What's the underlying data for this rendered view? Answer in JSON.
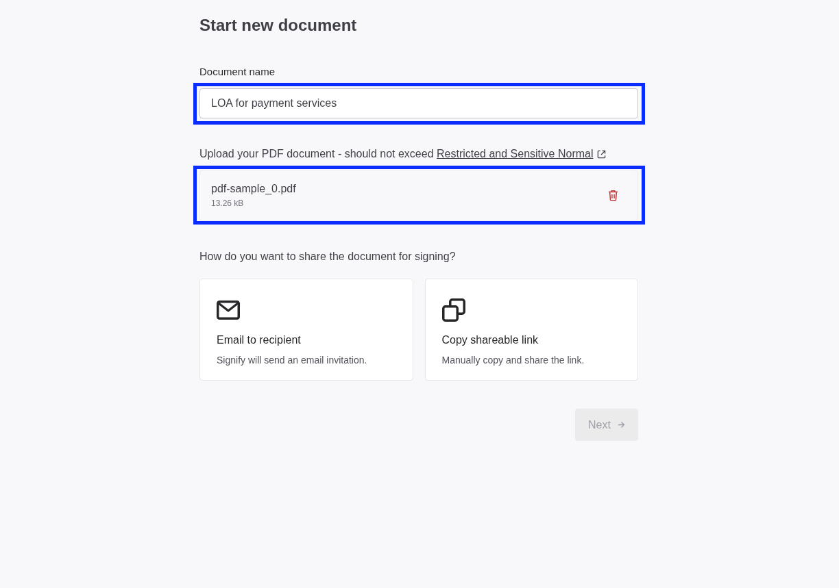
{
  "page": {
    "title": "Start new document"
  },
  "name_field": {
    "label": "Document name",
    "value": "LOA for payment services",
    "highlighted": true
  },
  "upload": {
    "label": "Upload your PDF document - should not exceed",
    "link": "Restricted and Sensitive Normal",
    "file": {
      "name": "pdf-sample_0.pdf",
      "size": "13.26 kB"
    },
    "highlighted": true
  },
  "share": {
    "question": "How do you want to share the document for signing?",
    "options": [
      {
        "kind": "email",
        "title": "Email to recipient",
        "description": "Signify will send an email invitation.",
        "selected": false
      },
      {
        "kind": "link",
        "title": "Copy shareable link",
        "description": "Manually copy and share the link.",
        "selected": false
      }
    ]
  },
  "next_button": {
    "label": "Next",
    "disabled": true
  }
}
